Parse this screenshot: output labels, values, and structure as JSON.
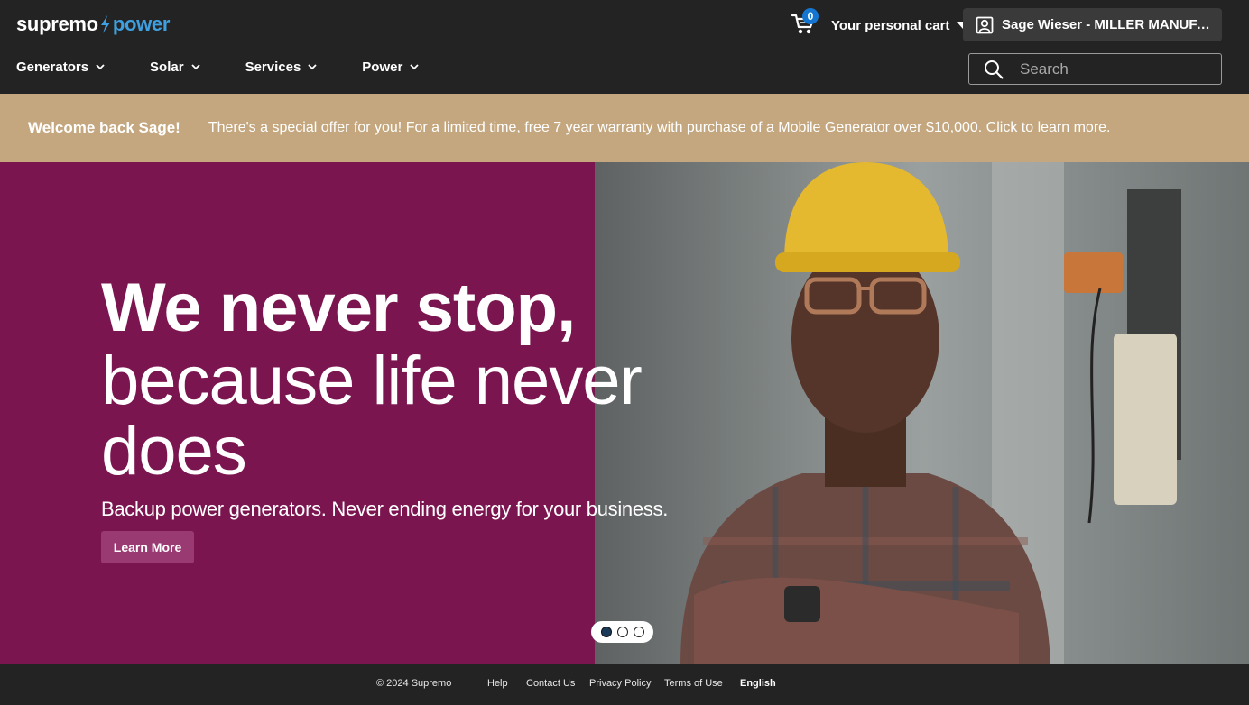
{
  "header": {
    "logo_a": "supremo",
    "logo_b": "power",
    "cart_count": "0",
    "cart_label": "Your personal cart",
    "account_label": "Sage Wieser - MILLER MANUFACT..."
  },
  "nav": {
    "items": [
      {
        "label": "Generators"
      },
      {
        "label": "Solar"
      },
      {
        "label": "Services"
      },
      {
        "label": "Power"
      }
    ]
  },
  "search": {
    "placeholder": "Search"
  },
  "promo": {
    "welcome": "Welcome back Sage!",
    "offer": "There's a special offer for you! For a limited time, free 7 year warranty with purchase of a Mobile Generator over $10,000. Click to learn more."
  },
  "hero": {
    "headline_bold": "We never stop,",
    "headline_light": "because life never does",
    "subtitle": "Backup power generators. Never ending energy for your business.",
    "cta": "Learn More",
    "slide_count": 3,
    "active_slide": 1
  },
  "footer": {
    "copyright": "© 2024 Supremo",
    "links": [
      "Help",
      "Contact Us",
      "Privacy Policy",
      "Terms of Use"
    ],
    "language": "English"
  },
  "colors": {
    "header_bg": "#232323",
    "promo_bg": "#c4a77e",
    "hero_bg": "#7b1550",
    "brand_accent": "#3ea0e0",
    "badge": "#1576d1",
    "button": "#9a3a72"
  },
  "icons": [
    "cart-icon",
    "chevron-down-icon",
    "user-icon",
    "search-icon",
    "bolt-icon"
  ]
}
